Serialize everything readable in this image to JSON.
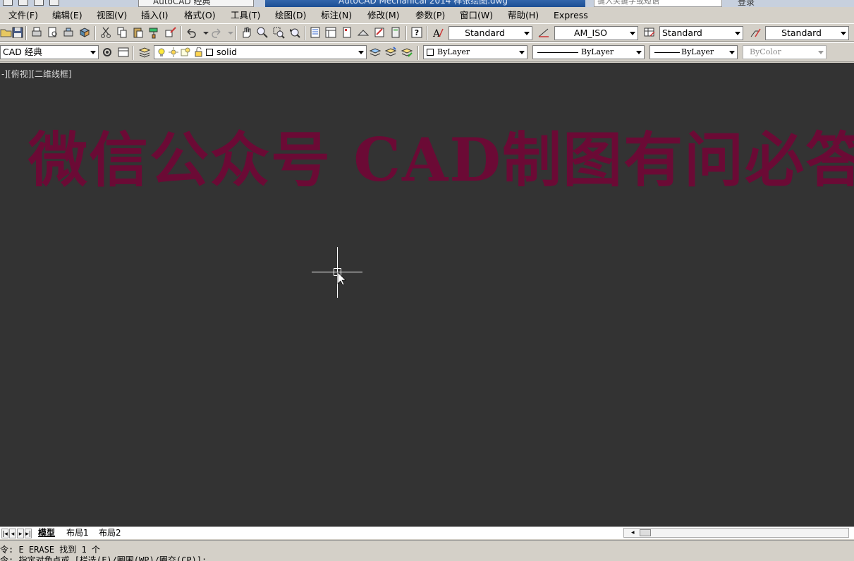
{
  "title_bar": {
    "workspace_label": "AutoCAD 经典",
    "app_title": "AutoCAD Mechanical 2014    样张绘图.dwg",
    "search_placeholder": "键入关键字或短语",
    "login_label": "登录"
  },
  "menu": [
    "文件(F)",
    "编辑(E)",
    "视图(V)",
    "插入(I)",
    "格式(O)",
    "工具(T)",
    "绘图(D)",
    "标注(N)",
    "修改(M)",
    "参数(P)",
    "窗口(W)",
    "帮助(H)",
    "Express"
  ],
  "toolbar_styles": {
    "text_style": "Standard",
    "dim_style": "AM_ISO",
    "table_style": "Standard",
    "multileader_style": "Standard"
  },
  "toolbar_workspace": {
    "workspace": "CAD 经典"
  },
  "layer_bar": {
    "current_layer": "solid",
    "color": "ByLayer",
    "linetype": "ByLayer",
    "lineweight": "ByLayer",
    "plotstyle": "ByColor"
  },
  "viewport": {
    "label": "-][俯视][二维线框]"
  },
  "watermark": {
    "text": "微信公众号  CAD制图有问必答",
    "color": "#6b0a35"
  },
  "canvas_colors": {
    "background": "#333333",
    "crosshair": "#ffffff"
  },
  "layout_tabs": [
    "模型",
    "布局1",
    "布局2"
  ],
  "active_tab": "模型",
  "command_line": {
    "line1": "令: E ERASE 找到 1 个",
    "line2": "令: 指定对角点或 [栏选(F)/圈围(WP)/圈交(CP)]:"
  }
}
